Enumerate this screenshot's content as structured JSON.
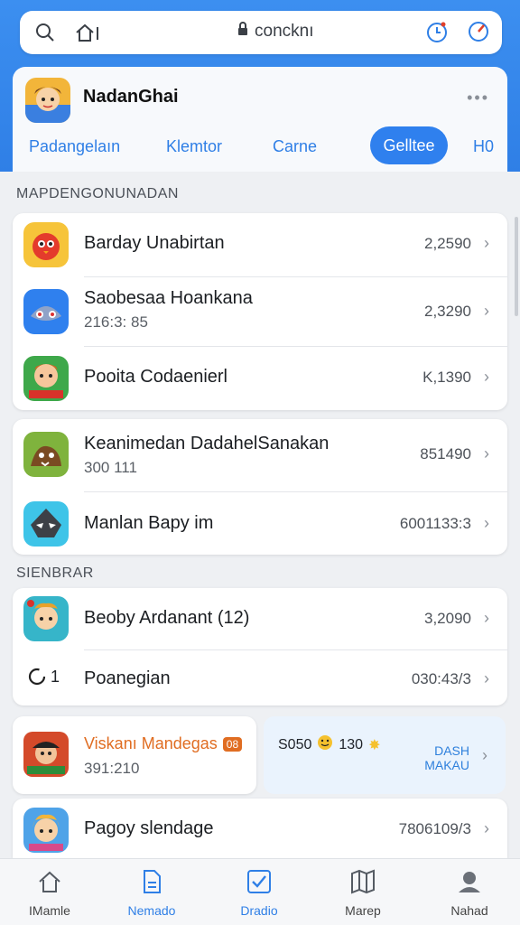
{
  "browser": {
    "url": "concknı"
  },
  "app": {
    "title": "NadanGhai",
    "tabs": [
      "Padangelaın",
      "Klemtor",
      "Carne",
      "Gelltee",
      "H0"
    ]
  },
  "sections": {
    "first_label": "MAPDENGONUNADAN",
    "second_label": "SIENBRAR"
  },
  "group1": [
    {
      "title": "Barday Unabirtan",
      "sub": "",
      "value": "2,2590"
    },
    {
      "title": "Saobesaa Hoankana",
      "sub": "216:3: 85",
      "value": "2,3290"
    },
    {
      "title": "Pooita Codaenierl",
      "sub": "",
      "value": "K,1390"
    }
  ],
  "group2": [
    {
      "title": "Keanimedan DadahelSanakan",
      "sub": "300 111",
      "value": "851490"
    },
    {
      "title": "Manlan Bapy im",
      "sub": "",
      "value": "6001133:3"
    }
  ],
  "group3": [
    {
      "title": "Beoby Ardanant (12)",
      "sub": "",
      "value": "3,2090"
    },
    {
      "title": "Poanegian",
      "sub": "",
      "value": "030:43/3",
      "leading": "1"
    }
  ],
  "split_card": {
    "title": "Viskanı Mandegas",
    "badge": "08",
    "sub": "391:210",
    "stat1": "S050",
    "stat2": "130",
    "cta": "DASH\nMAKAU"
  },
  "last_row": {
    "title": "Pagoy slendage",
    "value": "7806109/3"
  },
  "bottom_nav": [
    "IMamle",
    "Nemado",
    "Dradio",
    "Marep",
    "Nahad"
  ],
  "colors": {
    "accent": "#2f7fe6",
    "cta": "#2d7fdc",
    "orange": "#e06d22"
  }
}
